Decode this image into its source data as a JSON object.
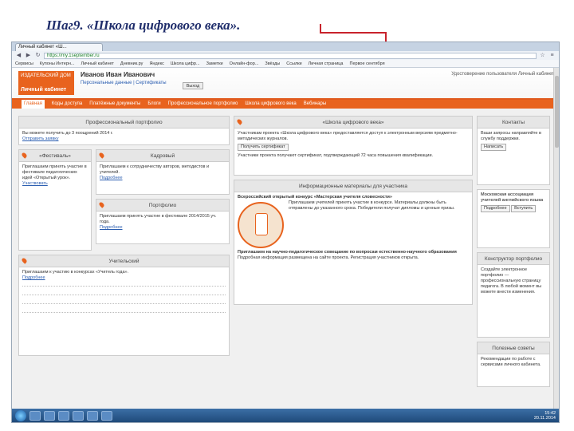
{
  "slide": {
    "title": "Шаг9.  «Школа цифрового века»."
  },
  "browser": {
    "tab_label": "Личный кабинет «Ш...",
    "url": "https://my.1september.ru",
    "bookmarks": [
      "Сервисы",
      "Купоны Интерн...",
      "Личный кабинет",
      "Дневник.ру",
      "Яндекс",
      "Школа цифр...",
      "Заметки",
      "Онлайн-фор...",
      "Звёзды",
      "Ссылки",
      "Личная страница",
      "Первое сентября"
    ]
  },
  "site": {
    "logo_top": "ИЗДАТЕЛЬСКИЙ ДОМ",
    "logo_name": "Личный кабинет",
    "user_name": "Иванов Иван Иванович",
    "user_links": "Персональные данные | Сертификаты",
    "user_btn": "Выход",
    "right_info": "Удостоверение пользователя\nЛичный кабинет",
    "menu": [
      "Главная",
      "Коды доступа",
      "Платёжные документы",
      "Блоги",
      "Профессиональное портфолио",
      "Школа цифрового века",
      "Вебинары"
    ]
  },
  "left_col": {
    "prof_title": "Профессиональный портфолио",
    "prof_text": "Вы можете получить до 3 поощрений 2014 г.",
    "prof_link": "Отправить заявку",
    "festival_title": "«Фестиваль»",
    "festival_text": "Приглашаем принять участие в фестивале педагогических идей «Открытый урок».",
    "festival_link": "Участвовать",
    "cadre_title": "Кадровый",
    "cadre_text": "Приглашаем к сотрудничеству авторов, методистов и учителей.",
    "cadre_link": "Подробнее",
    "teacher_title": "Портфолио",
    "teacher_text": "Приглашаем принять участие в фестивале 2014/2015 уч. года.",
    "teacher_link": "Подробнее",
    "pedagog_title": "Учительский",
    "pedagog_text": "Приглашаем к участию в конкурсах «Учитель года».",
    "pedagog_link": "Подробнее"
  },
  "center": {
    "news_title": "«Школа цифрового века»",
    "news_text1": "Участникам проекта «Школа цифрового века» предоставляется доступ к электронным версиям предметно-методических журналов.",
    "news_btn": "Получить сертификат",
    "news_text2": "Участники проекта получают сертификат, подтверждающий 72 часа повышения квалификации.",
    "info_title": "Информационные материалы для участника",
    "contest_title": "Всероссийский открытый конкурс «Мастерская учителя словесности»",
    "contest_text": "Приглашаем учителей принять участие в конкурсе. Материалы должны быть отправлены до указанного срока. Победители получат дипломы и ценные призы.",
    "announce_title": "Приглашаем на научно-педагогическое совещание по вопросам естественно-научного образования",
    "announce_text": "Подробная информация размещена на сайте проекта. Регистрация участников открыта."
  },
  "right_col": {
    "contacts_title": "Контакты",
    "contacts_text": "Ваши запросы направляйте в службу поддержки.",
    "contacts_link": "Написать",
    "assoc_title": "Московская ассоциация учителей английского языка",
    "assoc_btn1": "Подробнее",
    "assoc_btn2": "Вступить",
    "constructor_title": "Конструктор портфолио",
    "constructor_text": "Создайте электронное портфолио — профессиональную страницу педагога. В любой момент вы можете внести изменения.",
    "useful_title": "Полезные советы",
    "useful_text": "Рекомендации по работе с сервисами личного кабинета."
  },
  "taskbar": {
    "time": "15:42",
    "date": "20.11.2014"
  }
}
